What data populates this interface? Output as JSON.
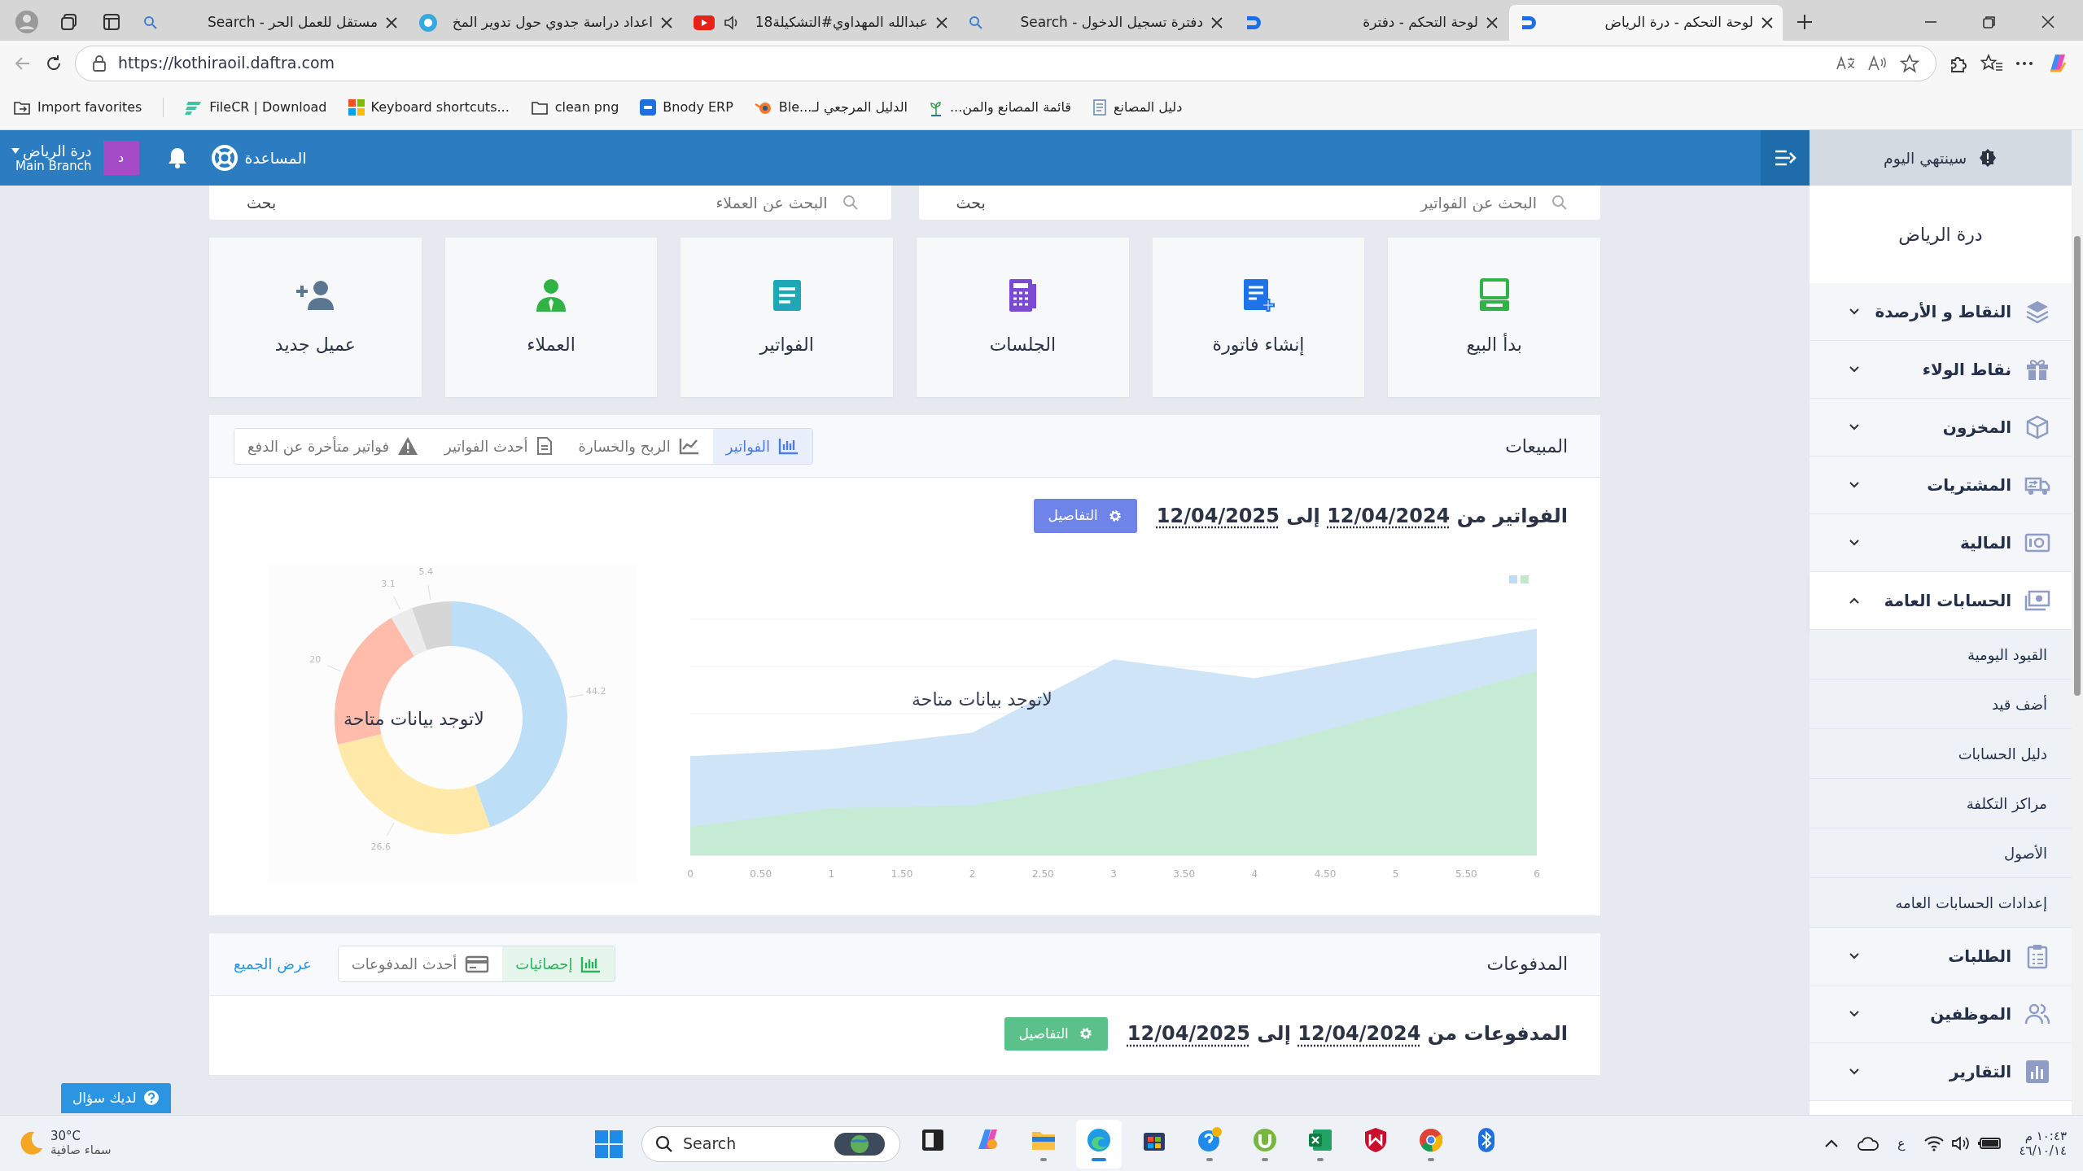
{
  "browser": {
    "tabs": [
      {
        "title": "لوحة التحكم - درة الرياض",
        "kind": "app",
        "audio": false,
        "selected": true
      },
      {
        "title": "لوحة التحكم - دفترة",
        "kind": "app",
        "audio": false,
        "selected": false
      },
      {
        "title": "دفترة تسجيل الدخول - Search",
        "kind": "search",
        "audio": false,
        "selected": false
      },
      {
        "title": "عبدالله المهداوي#التشكيلة18",
        "kind": "video",
        "audio": true,
        "selected": false
      },
      {
        "title": "اعداد دراسة جدوي حول تدوير المخ",
        "kind": "site",
        "audio": false,
        "selected": false
      },
      {
        "title": "مستقل للعمل الحر - Search",
        "kind": "search",
        "audio": false,
        "selected": false
      }
    ],
    "address": "https://kothiraoil.daftra.com",
    "bookmarks": [
      {
        "title": "دليل المصانع",
        "kind": "doc"
      },
      {
        "title": "قائمة المصانع والمن...",
        "kind": "plant"
      },
      {
        "title": "الدليل المرجعي لـ...Ble",
        "kind": "blender"
      },
      {
        "title": "Bnody ERP",
        "kind": "bnody"
      },
      {
        "title": "clean png",
        "kind": "folder"
      },
      {
        "title": "Keyboard shortcuts...",
        "kind": "windows"
      },
      {
        "title": "FileCR | Download",
        "kind": "filecr"
      },
      {
        "title": "Import favorites",
        "kind": "import"
      }
    ]
  },
  "header": {
    "branch": "درة الرياض",
    "branch_sub": "Main Branch",
    "avatar": "د",
    "help": "المساعدة"
  },
  "sidebar": {
    "notice": "سينتهي اليوم",
    "company": "درة الرياض",
    "items": [
      {
        "label": "النقاط و الأرصدة",
        "kind": "layers",
        "expanded": false
      },
      {
        "label": "نقاط الولاء",
        "kind": "gift",
        "expanded": false
      },
      {
        "label": "المخزون",
        "kind": "box",
        "expanded": false
      },
      {
        "label": "المشتريات",
        "kind": "truck",
        "expanded": false
      },
      {
        "label": "المالية",
        "kind": "safe",
        "expanded": false
      },
      {
        "label": "الحسابات العامة",
        "kind": "money",
        "expanded": true,
        "children": [
          {
            "label": "القيود اليومية"
          },
          {
            "label": "أضف قيد"
          },
          {
            "label": "دليل الحسابات"
          },
          {
            "label": "مراكز التكلفة"
          },
          {
            "label": "الأصول"
          },
          {
            "label": "إعدادات الحسابات العامه"
          }
        ]
      },
      {
        "label": "الطلبات",
        "kind": "clipboard",
        "expanded": false
      },
      {
        "label": "الموظفين",
        "kind": "people",
        "expanded": false
      },
      {
        "label": "التقارير",
        "kind": "report",
        "expanded": false
      }
    ]
  },
  "searches": [
    {
      "placeholder": "البحث عن الفواتير",
      "button": "بحث"
    },
    {
      "placeholder": "البحث عن العملاء",
      "button": "بحث"
    }
  ],
  "quick_actions": [
    {
      "label": "بدأ البيع",
      "kind": "pos"
    },
    {
      "label": "إنشاء فاتورة",
      "kind": "new-invoice"
    },
    {
      "label": "الجلسات",
      "kind": "sessions"
    },
    {
      "label": "الفواتير",
      "kind": "invoices"
    },
    {
      "label": "العملاء",
      "kind": "clients"
    },
    {
      "label": "عميل جديد",
      "kind": "new-client"
    }
  ],
  "sales": {
    "title": "المبيعات",
    "tabs": [
      {
        "label": "الفواتير",
        "kind": "bars",
        "selected": true
      },
      {
        "label": "الربح والخسارة",
        "kind": "line",
        "selected": false
      },
      {
        "label": "أحدث الفواتير",
        "kind": "doc",
        "selected": false
      },
      {
        "label": "فواتير متأخرة عن الدفع",
        "kind": "warning",
        "selected": false
      }
    ],
    "period": {
      "label": "الفواتير من",
      "from": "12/04/2024",
      "joiner": "إلى",
      "to": "12/04/2025"
    },
    "details_button": "التفاصيل",
    "area_chart": {
      "empty_message": "لاتوجد بيانات متاحة",
      "x_tick_labels": [
        "6",
        "5.50",
        "5",
        "4.50",
        "4",
        "3.50",
        "3",
        "2.50",
        "2",
        "1.50",
        "1",
        "0.50",
        "0"
      ]
    },
    "donut": {
      "empty_message": "لاتوجد بيانات متاحة",
      "chart_data": {
        "type": "donut",
        "values": [
          44.2,
          26.6,
          20,
          3.1,
          5.4
        ],
        "data_labels": true
      }
    }
  },
  "payments": {
    "title": "المدفوعات",
    "tabs": [
      {
        "label": "إحصائيات",
        "kind": "bars",
        "selected": true
      },
      {
        "label": "أحدث المدفوعات",
        "kind": "card",
        "selected": false
      }
    ],
    "view_all": "عرض الجميع",
    "period": {
      "label": "المدفوعات من",
      "from": "12/04/2024",
      "joiner": "إلى",
      "to": "12/04/2025"
    },
    "details_button": "التفاصيل"
  },
  "help_button": "لديك سؤال",
  "taskbar": {
    "temperature": "30°C",
    "weather": "سماء صافية",
    "search_placeholder": "Search",
    "apps": [
      {
        "kind": "terminal",
        "running": false,
        "selected": false
      },
      {
        "kind": "copilot",
        "running": false,
        "selected": false
      },
      {
        "kind": "explorer",
        "running": true,
        "selected": false
      },
      {
        "kind": "edge",
        "running": true,
        "selected": true
      },
      {
        "kind": "store",
        "running": false,
        "selected": false
      },
      {
        "kind": "help",
        "running": true,
        "selected": false
      },
      {
        "kind": "torrent",
        "running": true,
        "selected": false
      },
      {
        "kind": "excel",
        "running": true,
        "selected": false
      },
      {
        "kind": "shield",
        "running": false,
        "selected": false
      },
      {
        "kind": "chrome",
        "running": true,
        "selected": false
      },
      {
        "kind": "bluetooth",
        "running": false,
        "selected": false
      }
    ],
    "language": "ع",
    "time": "١٠:٤٣ م",
    "date": "٤٦/١٠/١٤"
  }
}
